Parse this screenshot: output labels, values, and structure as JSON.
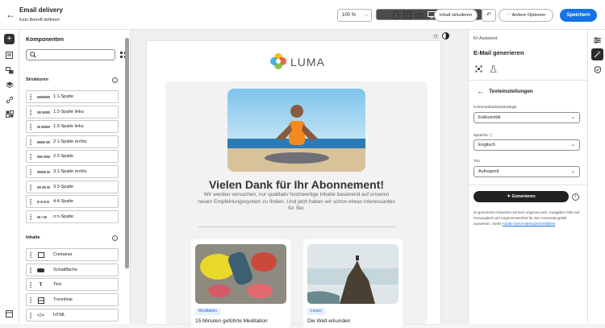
{
  "header": {
    "title": "Email delivery",
    "subtitle": "Kein Betreff definiert",
    "zoom": "100 %",
    "simulate_label": "Inhalt simulieren",
    "more_options_label": "Andere Optionen",
    "save_label": "Speichern"
  },
  "components": {
    "title": "Komponenten",
    "structures_heading": "Strukturen",
    "structures": [
      {
        "label": "1:1-Spalte"
      },
      {
        "label": "1:2-Spalte links"
      },
      {
        "label": "1:3-Spalte links"
      },
      {
        "label": "2:1-Spalte rechts"
      },
      {
        "label": "2:2-Spalte"
      },
      {
        "label": "3:1-Spalte rechts"
      },
      {
        "label": "3:3-Spalte"
      },
      {
        "label": "4:4-Spalte"
      },
      {
        "label": "n:n-Spalte"
      }
    ],
    "content_heading": "Inhalte",
    "contents": [
      {
        "label": "Container",
        "icon": "container-icon"
      },
      {
        "label": "Schaltfläche",
        "icon": "button-icon"
      },
      {
        "label": "Text",
        "icon": "text-icon"
      },
      {
        "label": "Trennlinie",
        "icon": "divider-icon"
      },
      {
        "label": "HTML",
        "icon": "html-icon"
      }
    ]
  },
  "email": {
    "logo_text": "LUMA",
    "headline": "Vielen Dank für Ihr Abonnement!",
    "body": "Wir werden versuchen, nur qualitativ hochwertige Inhalte basierend auf unseren neuen Empfehlungssystem zu finden. Und jetzt haben wir schon etwas Interessantes für Sie:",
    "cards": [
      {
        "tag": "Meditation",
        "title": "15 Minuten geführte Meditation"
      },
      {
        "tag": "Lesen",
        "title": "Die Welt erkunden"
      }
    ]
  },
  "assistant": {
    "breadcrumb": "KI-Assistent",
    "title": "E-Mail generieren",
    "section_title": "Texteinstellungen",
    "strategy_label": "Kommunikationsstrategie",
    "strategy_value": "Exklusivität",
    "language_label": "Sprache",
    "language_value": "Englisch",
    "tone_label": "Ton",
    "tone_value": "Aufregend",
    "generate_label": "Generieren",
    "disclaimer": "KI-generierte Antworten können ungenau sein. Ausgaben bitte auf Genauigkeit und Angemessenheit für den Anwendungsfall auswerten. Siehe",
    "disclaimer_link": "Adobe GenAI-Benutzerrichtlinien"
  },
  "colors": {
    "accent": "#1473e6",
    "dark": "#222222"
  }
}
